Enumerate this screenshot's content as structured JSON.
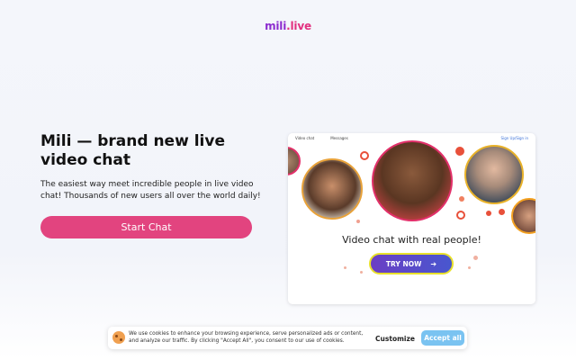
{
  "header": {
    "logo_part1": "mili",
    "logo_part2": ".live"
  },
  "hero": {
    "headline": "Mili — brand new live video chat",
    "subtext": "The easiest way meet incredible people in live video chat! Thousands of new users all over the world daily!",
    "start_button": "Start Chat"
  },
  "preview_card": {
    "tabs": [
      "Video chat",
      "Messages"
    ],
    "sign_in": "Sign Up/Sign in",
    "caption": "Video chat with real people!",
    "try_button": "TRY NOW",
    "try_icon": "arrow-right-icon",
    "colors": {
      "accent_pink": "#e2447f",
      "ring_red": "#e8503a",
      "button_purple": "#6b3ec4",
      "button_border": "#e8e02a"
    }
  },
  "cookie_banner": {
    "text": "We use cookies to enhance your browsing experience, serve personalized ads or content, and analyze our traffic. By clicking \"Accept All\", you consent to our use of cookies.",
    "customize_label": "Customize",
    "accept_label": "Accept all",
    "icon": "cookie-icon"
  }
}
